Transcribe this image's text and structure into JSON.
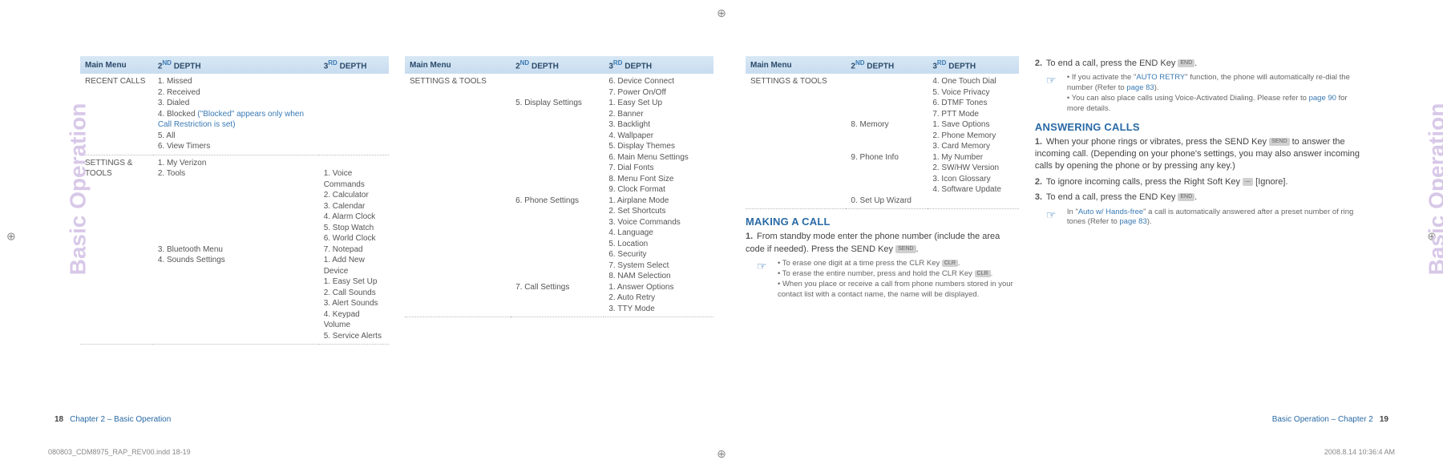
{
  "crop_glyph": "⊕",
  "side_label": "Basic Operation",
  "table_headers": {
    "col1": "Main Menu",
    "col2_pre": "2",
    "col2_sup": "ND",
    "col2_post": " DEPTH",
    "col3_pre": "3",
    "col3_sup": "RD",
    "col3_post": " DEPTH"
  },
  "table1": {
    "row1_c1": "RECENT CALLS",
    "row1_c2": "1. Missed\n2. Received\n3. Dialed\n4. Blocked",
    "row1_c2_note": " (\"Blocked\" appears only when Call Restriction is set)",
    "row1_c2b": "5. All\n6. View Timers",
    "row2_c1": "SETTINGS & TOOLS",
    "row2_c2a": "1. My Verizon\n2. Tools",
    "row2_c3a": "1. Voice Commands\n2. Calculator\n3. Calendar\n4. Alarm Clock\n5. Stop Watch\n6. World Clock\n7. Notepad",
    "row2_c2b": "3. Bluetooth Menu\n4. Sounds Settings",
    "row2_c3b": "1. Add New Device\n1. Easy Set Up\n2. Call Sounds\n3. Alert Sounds\n4. Keypad Volume\n5. Service Alerts"
  },
  "table2": {
    "row1_c1": "SETTINGS & TOOLS",
    "row1_c2a": "5. Display Settings",
    "row1_c3a": "6. Device Connect\n7. Power On/Off\n1. Easy Set Up\n2. Banner\n3. Backlight\n4. Wallpaper\n5. Display Themes\n6. Main Menu Settings\n7. Dial Fonts\n8. Menu Font Size\n9. Clock Format",
    "row1_c2b": "6. Phone Settings",
    "row1_c3b": "1. Airplane Mode\n2. Set Shortcuts\n3. Voice Commands\n4. Language\n5. Location\n6. Security\n7. System Select\n8. NAM Selection",
    "row1_c2c": "7. Call Settings",
    "row1_c3c": "1. Answer Options\n2. Auto Retry\n3. TTY Mode"
  },
  "table3": {
    "row1_c1": "SETTINGS & TOOLS",
    "row1_c3a": "4. One Touch Dial\n5. Voice Privacy\n6. DTMF Tones\n7. PTT Mode",
    "row1_c2b": "8. Memory",
    "row1_c3b": "1. Save Options\n2. Phone Memory\n3. Card Memory",
    "row1_c2c": "9. Phone Info",
    "row1_c3c": "1. My Number\n2. SW/HW Version\n3. Icon Glossary\n4. Software Update",
    "row1_c2d": "0. Set Up Wizard"
  },
  "making_call_h": "MAKING A CALL",
  "making_call_1": "From standby mode enter the phone number (include the area code if needed). Press the SEND Key ",
  "making_call_key": "SEND",
  "making_call_tips": {
    "t1a": "To erase one digit at a time press the CLR Key ",
    "t1a_key": "CLR",
    "t1b": "To erase the entire number, press and hold the CLR Key ",
    "t1b_key": "CLR",
    "t1c": "When you place or receive a call from phone numbers stored in your contact list with a contact name, the name will be displayed."
  },
  "right_col": {
    "step2": "To end a call, press the END Key ",
    "step2_key": "END",
    "tip2a_pre": "If you activate the \"",
    "tip2a_link": "AUTO RETRY",
    "tip2a_post": "\" function, the phone will automatically re-dial the number (Refer to ",
    "tip2a_page": "page 83",
    "tip2a_end": ").",
    "tip2b_pre": "You can also place calls using Voice-Activated Dialing. Please refer to ",
    "tip2b_page": "page 90",
    "tip2b_post": " for more details."
  },
  "answering_h": "ANSWERING CALLS",
  "answering_1_pre": "When your phone rings or vibrates, press the SEND Key ",
  "answering_1_key": "SEND",
  "answering_1_post": " to answer the incoming call. (Depending on your phone's settings, you may also answer incoming calls by opening the phone or by pressing any key.)",
  "answering_2_pre": "To ignore incoming calls, press the Right Soft Key ",
  "answering_2_key": "—",
  "answering_2_post": " [Ignore].",
  "answering_3_pre": "To end a call, press the END Key ",
  "answering_3_key": "END",
  "answering_tip_pre": "In \"",
  "answering_tip_link": "Auto w/ Hands-free",
  "answering_tip_mid": "\" a call is automatically answered after a preset number of ring tones (Refer to ",
  "answering_tip_page": "page 83",
  "answering_tip_end": ").",
  "footer_left_num": "18",
  "footer_left_text": "Chapter 2 – Basic Operation",
  "footer_right_text": "Basic Operation – Chapter 2",
  "footer_right_num": "19",
  "doc_file": "080803_CDM8975_RAP_REV00.indd   18-19",
  "doc_time": "2008.8.14   10:36:4 AM",
  "period": "."
}
